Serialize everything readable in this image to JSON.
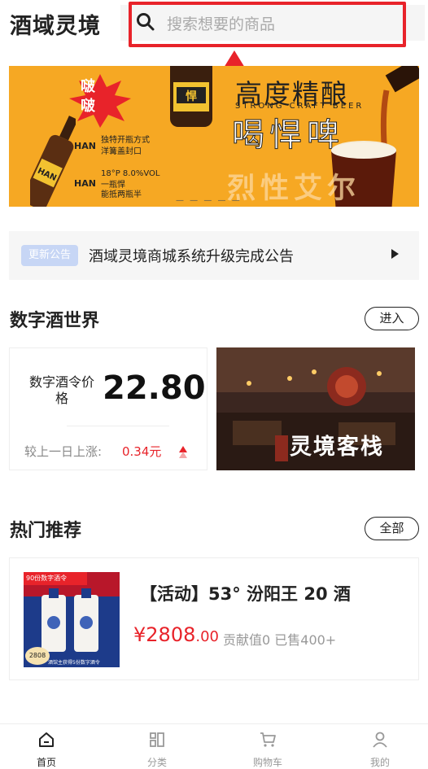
{
  "header": {
    "logo": "酒域灵境",
    "search_placeholder": "搜索想要的商品"
  },
  "banner": {
    "title_cn": "高度精酿",
    "title_en": "STRONG CRAFT BEER",
    "title2": "喝悍啤",
    "pop_text": "啵啵",
    "brand": "HAN",
    "feature1": "独特开瓶方式",
    "feature2": "洋篝盖封口",
    "spec": "18°P  8.0%VOL",
    "spec2": "一瓶悍",
    "spec3": "能抵两瓶半",
    "bottom_text": "烈性艾尔"
  },
  "notice": {
    "tag": "更新公告",
    "text": "酒域灵境商城系统升级完成公告"
  },
  "digital_world": {
    "title": "数字酒世界",
    "enter_button": "进入",
    "price_label": "数字酒令价格",
    "price_value": "22.80",
    "rise_label": "较上一日上涨:",
    "rise_value": "0.34元",
    "game_title": "灵境客栈"
  },
  "hot": {
    "title": "热门推荐",
    "all_button": "全部",
    "products": [
      {
        "image_tag": "90份数字酒令",
        "image_price": "2808",
        "image_footer": "酒馆主获得5份数字酒令",
        "name": "【活动】53° 汾阳王 20 酒",
        "price_symbol": "¥",
        "price_int": "2808",
        "price_dec": ".00",
        "meta": "贡献值0  已售400+"
      }
    ]
  },
  "tabbar": {
    "items": [
      {
        "label": "首页",
        "icon": "home-icon",
        "active": true
      },
      {
        "label": "分类",
        "icon": "category-icon",
        "active": false
      },
      {
        "label": "购物车",
        "icon": "cart-icon",
        "active": false
      },
      {
        "label": "我的",
        "icon": "user-icon",
        "active": false
      }
    ]
  },
  "colors": {
    "accent": "#e8232a",
    "banner_bg": "#f6a823",
    "notice_tag": "#c7d6f5"
  }
}
